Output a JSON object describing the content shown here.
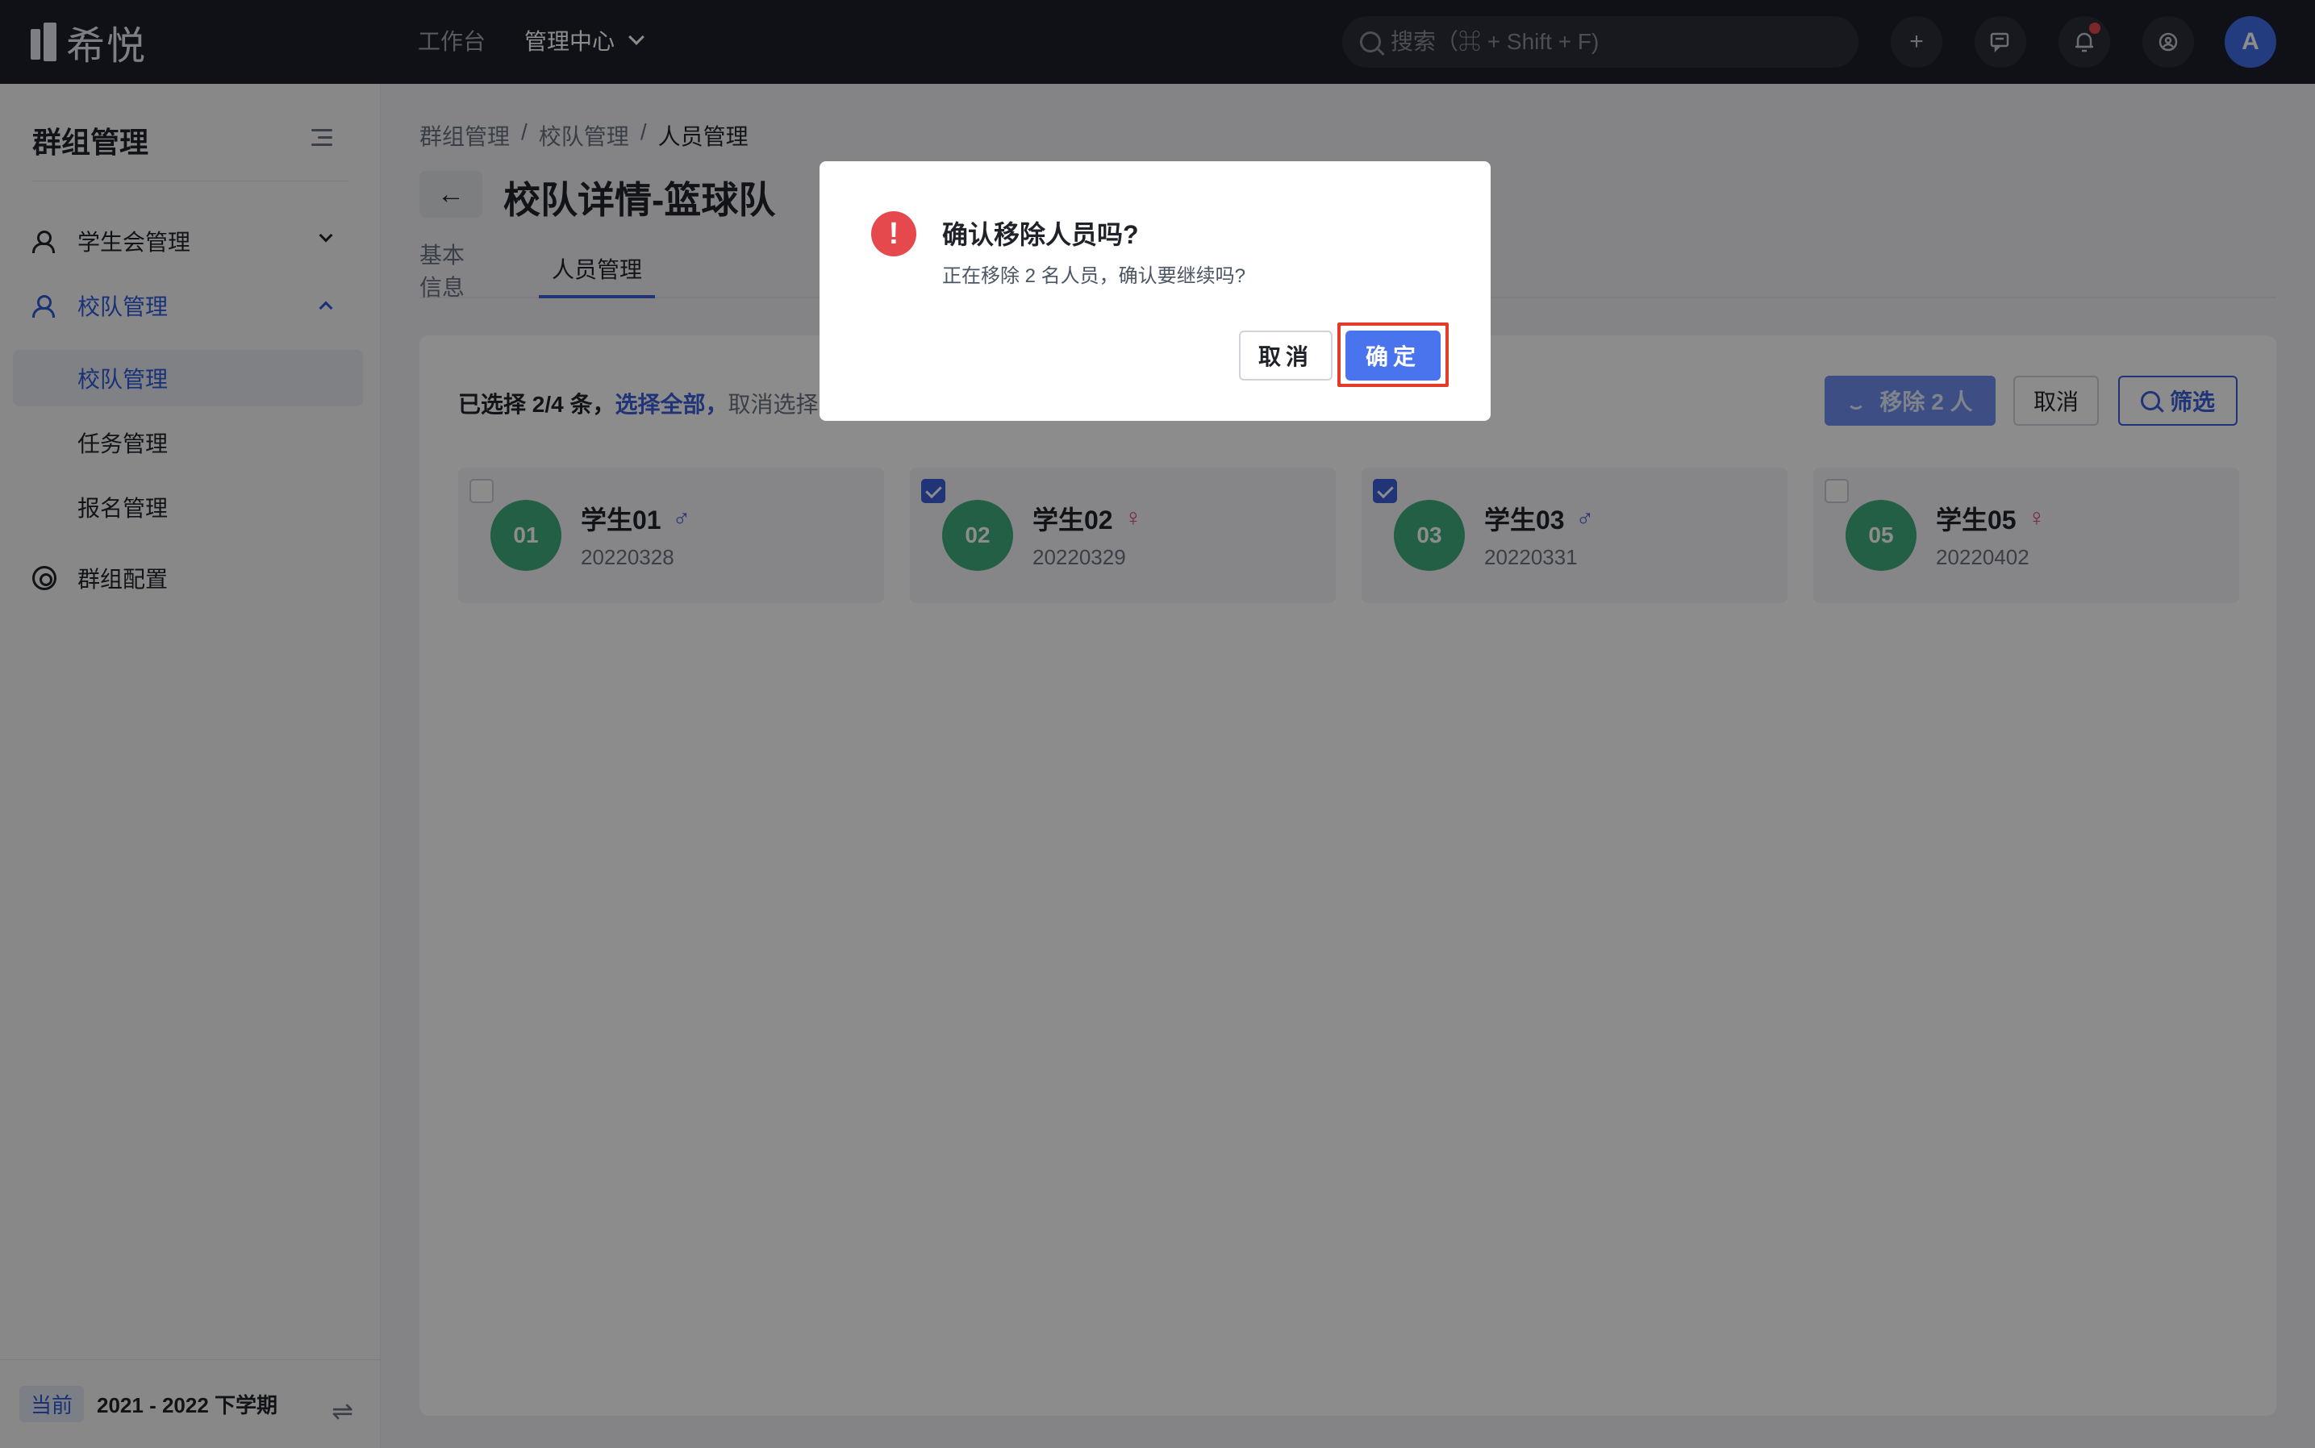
{
  "topbar": {
    "logo_text": "希悦",
    "nav": [
      {
        "label": "工作台"
      },
      {
        "label": "管理中心"
      }
    ],
    "search_placeholder": "搜索（⌘ + Shift + F)",
    "avatar": "A",
    "icons": [
      "plus-icon",
      "message-icon",
      "bell-icon",
      "app-switch-icon"
    ]
  },
  "sidebar": {
    "title": "群组管理",
    "items": [
      {
        "label": "学生会管理"
      },
      {
        "label": "校队管理"
      },
      {
        "label": "群组配置"
      }
    ],
    "subitems": [
      {
        "label": "校队管理"
      },
      {
        "label": "任务管理"
      },
      {
        "label": "报名管理"
      }
    ],
    "footer": {
      "badge": "当前",
      "term": "2021 - 2022 下学期"
    }
  },
  "main": {
    "breadcrumb": [
      "群组管理",
      "校队管理",
      "人员管理"
    ],
    "title": "校队详情-篮球队",
    "tabs": [
      {
        "label": "基本信息"
      },
      {
        "label": "人员管理"
      }
    ],
    "selection": {
      "prefix": "已选择 2/4 条，",
      "select_all": "选择全部，",
      "clear": "取消选择"
    },
    "actions": {
      "remove": "移除 2 人",
      "cancel": "取消",
      "filter": "筛选"
    },
    "members": [
      {
        "num": "01",
        "name": "学生01",
        "gender": "♂",
        "id": "20220328",
        "checked": false
      },
      {
        "num": "02",
        "name": "学生02",
        "gender": "♀",
        "id": "20220329",
        "checked": true
      },
      {
        "num": "03",
        "name": "学生03",
        "gender": "♂",
        "id": "20220331",
        "checked": true
      },
      {
        "num": "05",
        "name": "学生05",
        "gender": "♀",
        "id": "20220402",
        "checked": false
      }
    ]
  },
  "modal": {
    "title": "确认移除人员吗?",
    "message": "正在移除 2 名人员，确认要继续吗?",
    "cancel": "取消",
    "ok": "确定"
  },
  "colors": {
    "primary": "#3b5fd9",
    "danger": "#e5484d",
    "avatar_green": "#3fae7c",
    "highlight": "#e23b2a"
  }
}
